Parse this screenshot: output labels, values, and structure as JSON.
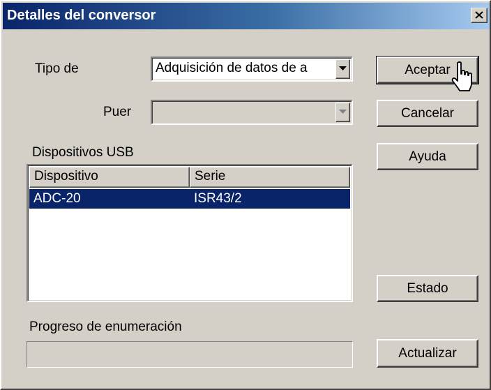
{
  "window": {
    "title": "Detalles del conversor",
    "close_label": "close"
  },
  "tipo": {
    "label": "Tipo de",
    "value": "Adquisición de datos de a"
  },
  "puerto": {
    "label": "Puer",
    "value": ""
  },
  "usb_section": {
    "label": "Dispositivos USB",
    "columns": [
      "Dispositivo",
      "Serie"
    ],
    "rows": [
      {
        "dispositivo": "ADC-20",
        "serie": "ISR43/2",
        "selected": true
      }
    ]
  },
  "progress": {
    "label": "Progreso de enumeración",
    "value": 0
  },
  "buttons": {
    "aceptar": "Aceptar",
    "cancelar": "Cancelar",
    "ayuda": "Ayuda",
    "estado": "Estado",
    "actualizar": "Actualizar"
  },
  "colors": {
    "selection": "#0a246a",
    "face": "#d4d0c8"
  },
  "icons": {
    "dropdown": "chevron-down-icon",
    "close": "close-icon",
    "cursor": "hand-pointer-icon"
  }
}
